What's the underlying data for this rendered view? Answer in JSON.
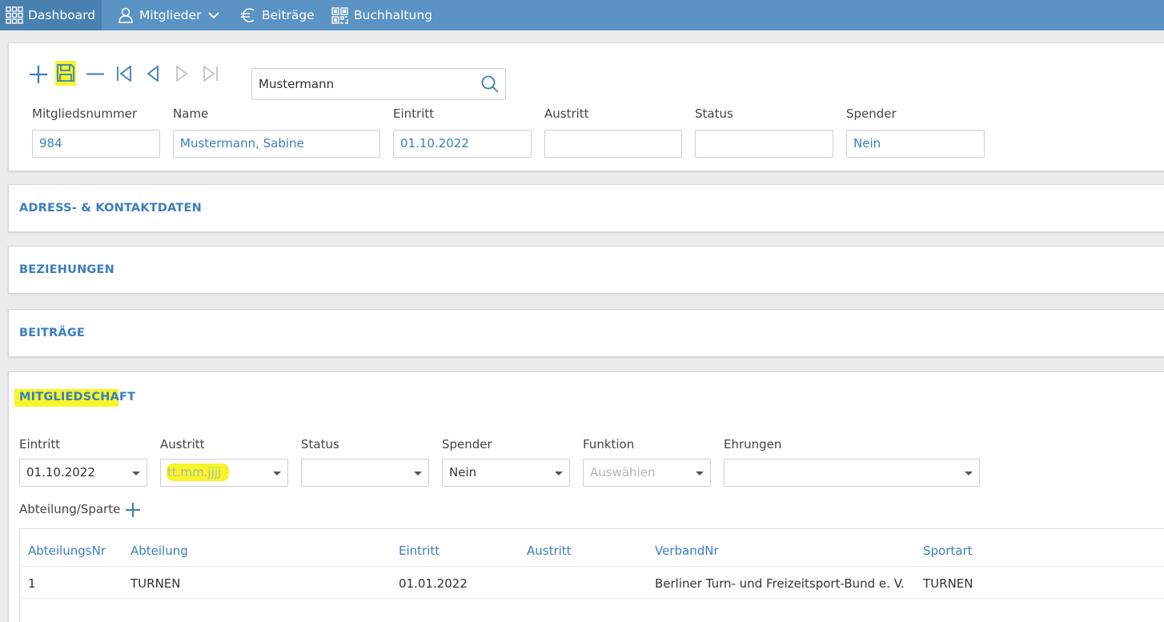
{
  "nav": {
    "dashboard": "Dashboard",
    "mitglieder": "Mitglieder",
    "beitraege": "Beiträge",
    "buchhaltung": "Buchhaltung"
  },
  "toolbar": {
    "icons": [
      "add-icon",
      "save-icon",
      "delete-icon",
      "first-record-icon",
      "previous-record-icon",
      "next-record-icon",
      "last-record-icon"
    ]
  },
  "search": {
    "value": "Mustermann",
    "icon": "search-icon"
  },
  "header_fields": {
    "mitgliedsnummer": {
      "label": "Mitgliedsnummer",
      "value": "984"
    },
    "name": {
      "label": "Name",
      "value": "Mustermann, Sabine"
    },
    "eintritt": {
      "label": "Eintritt",
      "value": "01.10.2022"
    },
    "austritt": {
      "label": "Austritt",
      "value": ""
    },
    "status": {
      "label": "Status",
      "value": ""
    },
    "spender": {
      "label": "Spender",
      "value": "Nein"
    }
  },
  "sections": {
    "adress": "ADRESS- & KONTAKTDATEN",
    "beziehungen": "BEZIEHUNGEN",
    "beitraege": "BEITRÄGE",
    "mitgliedschaft": "MITGLIEDSCHAFT"
  },
  "membership": {
    "eintritt": {
      "label": "Eintritt",
      "value": "01.10.2022"
    },
    "austritt": {
      "label": "Austritt",
      "placeholder": "tt.mm.jjjj"
    },
    "status": {
      "label": "Status",
      "value": ""
    },
    "spender": {
      "label": "Spender",
      "value": "Nein"
    },
    "funktion": {
      "label": "Funktion",
      "placeholder": "Auswählen"
    },
    "ehrungen": {
      "label": "Ehrungen",
      "value": ""
    },
    "abteilung_label": "Abteilung/Sparte"
  },
  "table": {
    "columns": [
      "AbteilungsNr",
      "Abteilung",
      "Eintritt",
      "Austritt",
      "VerbandNr",
      "Sportart"
    ],
    "rows": [
      [
        "1",
        "TURNEN",
        "01.01.2022",
        "",
        "Berliner Turn- und Freizeitsport-Bund e. V.",
        "TURNEN"
      ]
    ]
  },
  "colors": {
    "nav_bg": "#5a93c4",
    "accent": "#3b7ec0",
    "highlight": "#f5f52a"
  }
}
